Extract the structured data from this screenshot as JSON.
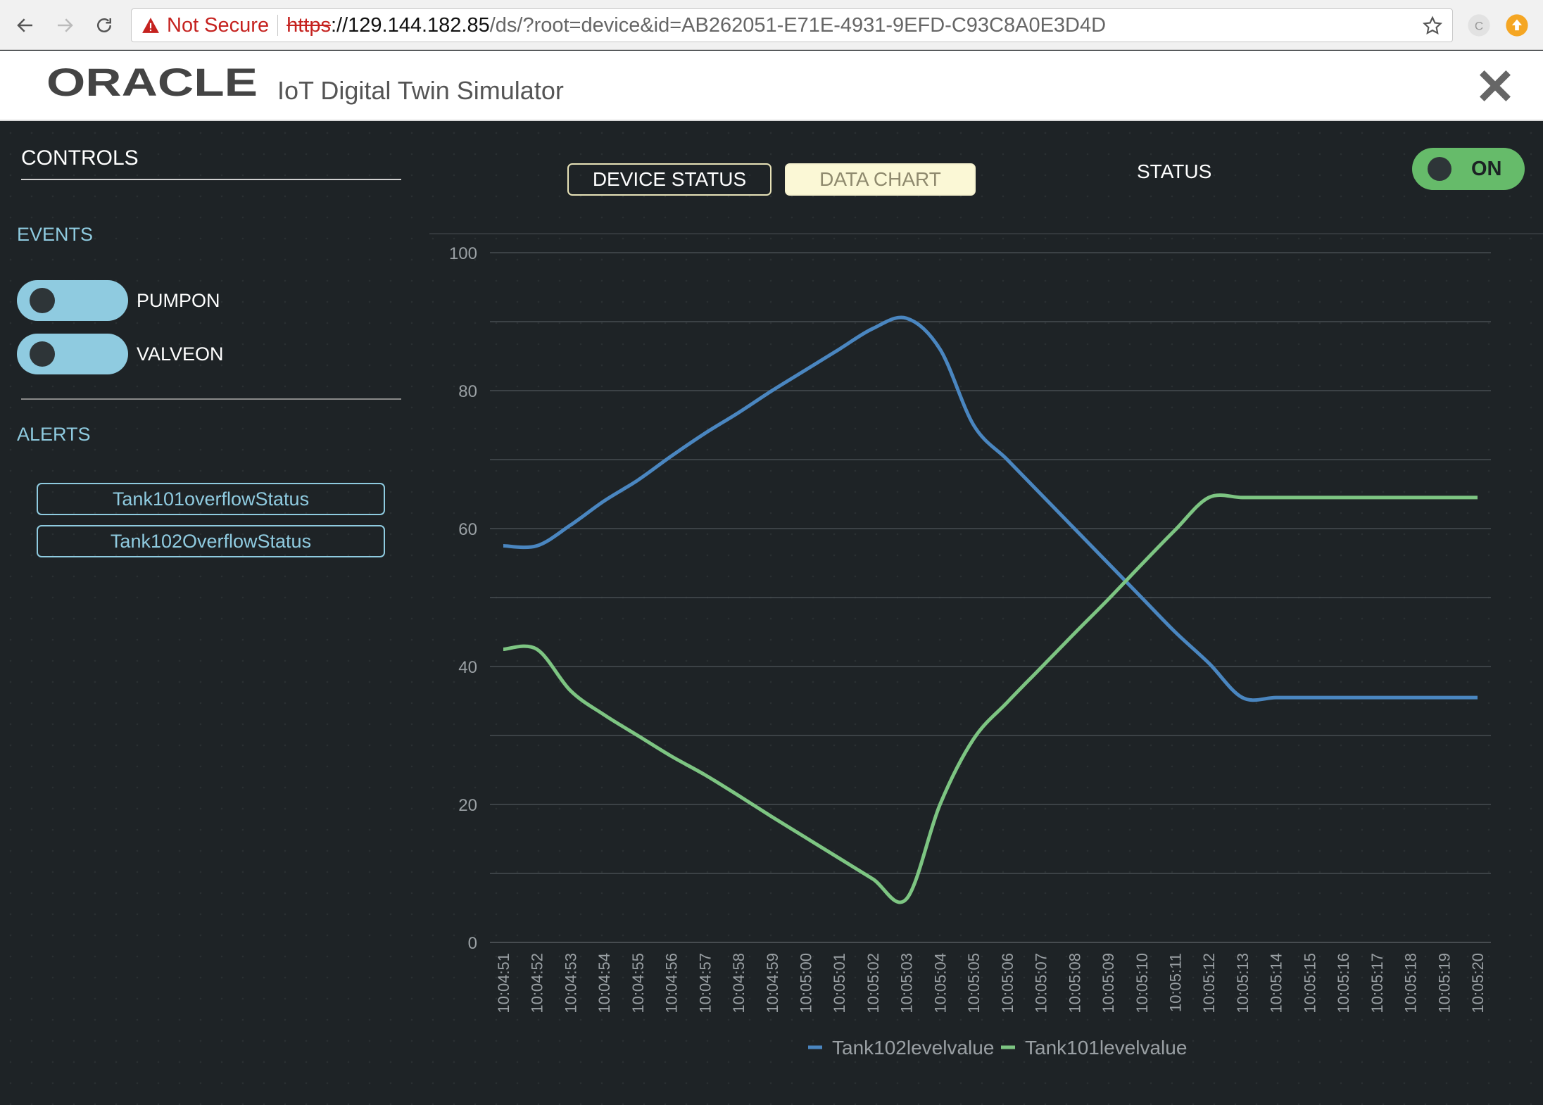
{
  "browser": {
    "security_label": "Not Secure",
    "url_protocol": "https",
    "url_host": "://129.144.182.85",
    "url_path": "/ds/?root=device&id=AB262051-E71E-4931-9EFD-C93C8A0E3D4D"
  },
  "header": {
    "logo_text": "ORACLE",
    "title": "IoT Digital Twin Simulator"
  },
  "sidebar": {
    "controls_title": "CONTROLS",
    "events_title": "EVENTS",
    "events": [
      {
        "label": "PUMPON",
        "state": "off"
      },
      {
        "label": "VALVEON",
        "state": "off"
      }
    ],
    "alerts_title": "ALERTS",
    "alerts": [
      "Tank101overflowStatus",
      "Tank102OverflowStatus"
    ]
  },
  "tabs": {
    "device_status": "DEVICE STATUS",
    "data_chart": "DATA CHART",
    "active": "DATA CHART"
  },
  "status": {
    "label": "STATUS",
    "toggle_text": "ON"
  },
  "colors": {
    "tank102": "#4a86c0",
    "tank101": "#7dc582",
    "accent": "#8fcbe0",
    "status_on": "#66bb6a"
  },
  "chart_data": {
    "type": "line",
    "x": [
      "10:04:51",
      "10:04:52",
      "10:04:53",
      "10:04:54",
      "10:04:55",
      "10:04:56",
      "10:04:57",
      "10:04:58",
      "10:04:59",
      "10:05:00",
      "10:05:01",
      "10:05:02",
      "10:05:03",
      "10:05:04",
      "10:05:05",
      "10:05:06",
      "10:05:07",
      "10:05:08",
      "10:05:09",
      "10:05:10",
      "10:05:11",
      "10:05:12",
      "10:05:13",
      "10:05:14",
      "10:05:15",
      "10:05:16",
      "10:05:17",
      "10:05:18",
      "10:05:19",
      "10:05:20"
    ],
    "ylim": [
      0,
      100
    ],
    "yticks": [
      0,
      20,
      40,
      60,
      80,
      100
    ],
    "grid": true,
    "legend": "bottom-center",
    "series": [
      {
        "name": "Tank102levelvalue",
        "color": "#4a86c0",
        "values": [
          57.5,
          57.5,
          60.5,
          64.0,
          67.0,
          70.5,
          73.8,
          76.8,
          80.0,
          83.0,
          86.0,
          89.0,
          90.5,
          86.0,
          75.0,
          70.0,
          65.0,
          60.0,
          55.0,
          50.0,
          45.0,
          40.5,
          35.5,
          35.5,
          35.5,
          35.5,
          35.5,
          35.5,
          35.5,
          35.5
        ]
      },
      {
        "name": "Tank101levelvalue",
        "color": "#7dc582",
        "values": [
          42.5,
          42.5,
          36.5,
          33.0,
          30.0,
          27.0,
          24.3,
          21.3,
          18.2,
          15.2,
          12.2,
          9.2,
          6.3,
          20.0,
          29.5,
          34.8,
          39.8,
          44.8,
          49.7,
          54.8,
          59.8,
          64.5,
          64.5,
          64.5,
          64.5,
          64.5,
          64.5,
          64.5,
          64.5,
          64.5
        ]
      }
    ]
  }
}
